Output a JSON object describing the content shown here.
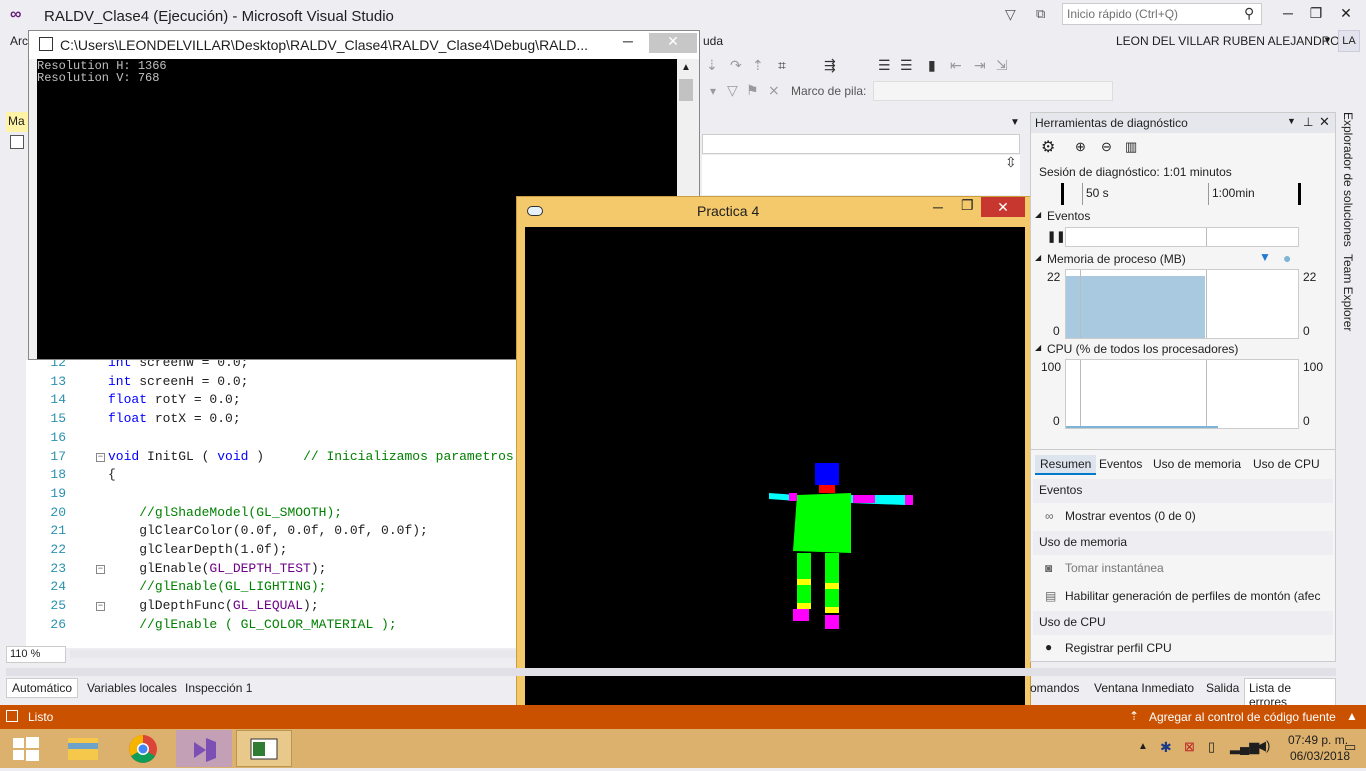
{
  "vs": {
    "title": "RALDV_Clase4 (Ejecución) - Microsoft Visual Studio",
    "quick_search_placeholder": "Inicio rápido (Ctrl+Q)",
    "user_name": "LEON DEL VILLAR RUBEN ALEJANDRO",
    "user_initials": "LA",
    "menu_partial_left": "Arc",
    "menu_partial_right": "uda",
    "stack_frame_label": "Marco de pila:",
    "tab_partial": "Ma",
    "zoom": "110 %",
    "colors": {
      "accent": "#68217a",
      "status_bar": "#ca5100",
      "taskbar": "#dcb16d"
    }
  },
  "console": {
    "title": "C:\\Users\\LEONDELVILLAR\\Desktop\\RALDV_Clase4\\RALDV_Clase4\\Debug\\RALD...",
    "lines": [
      "Resolution H: 1366",
      "Resolution V: 768"
    ]
  },
  "editor": {
    "lines": [
      {
        "num": "12",
        "code": "int screenW = 0.0;"
      },
      {
        "num": "13",
        "code": "int screenH = 0.0;"
      },
      {
        "num": "14",
        "code": "float rotY = 0.0;"
      },
      {
        "num": "15",
        "code": "float rotX = 0.0;"
      },
      {
        "num": "16",
        "code": ""
      },
      {
        "num": "17",
        "code": "void InitGL ( void )     // Inicializamos parametros"
      },
      {
        "num": "18",
        "code": "{"
      },
      {
        "num": "19",
        "code": ""
      },
      {
        "num": "20",
        "code": "    //glShadeModel(GL_SMOOTH);"
      },
      {
        "num": "21",
        "code": "    glClearColor(0.0f, 0.0f, 0.0f, 0.0f);"
      },
      {
        "num": "22",
        "code": "    glClearDepth(1.0f);"
      },
      {
        "num": "23",
        "code": "    glEnable(GL_DEPTH_TEST);"
      },
      {
        "num": "24",
        "code": "    //glEnable(GL_LIGHTING);"
      },
      {
        "num": "25",
        "code": "    glDepthFunc(GL_LEQUAL);"
      },
      {
        "num": "26",
        "code": "    //glEnable ( GL_COLOR_MATERIAL );"
      }
    ]
  },
  "glwindow": {
    "title": "Practica 4"
  },
  "diag": {
    "title": "Herramientas de diagnóstico",
    "session": "Sesión de diagnóstico: 1:01 minutos",
    "timeline": [
      "50 s",
      "1:00min"
    ],
    "events_label": "Eventos",
    "memory_label": "Memoria de proceso (MB)",
    "memory_max": "22",
    "memory_min": "0",
    "memory_fill_fraction": 0.6,
    "cpu_label": "CPU (% de todos los procesadores)",
    "cpu_max": "100",
    "cpu_min": "0",
    "tabs": [
      "Resumen",
      "Eventos",
      "Uso de memoria",
      "Uso de CPU"
    ],
    "sections": [
      {
        "header": "Eventos",
        "items": [
          "Mostrar eventos (0 de 0)"
        ]
      },
      {
        "header": "Uso de memoria",
        "items": [
          "Tomar instantánea",
          "Habilitar generación de perfiles de montón (afec"
        ]
      },
      {
        "header": "Uso de CPU",
        "items": [
          "Registrar perfil CPU"
        ]
      }
    ]
  },
  "side_tabs": [
    "Explorador de soluciones",
    "Team Explorer"
  ],
  "bottom_tabs_left": [
    "Automático",
    "Variables locales",
    "Inspección 1"
  ],
  "bottom_tabs_right": [
    "omandos",
    "Ventana Inmediato",
    "Salida",
    "Lista de errores"
  ],
  "status": {
    "left": "Listo",
    "right": "Agregar al control de código fuente"
  },
  "taskbar": {
    "time": "07:49 p. m.",
    "date": "06/03/2018"
  }
}
